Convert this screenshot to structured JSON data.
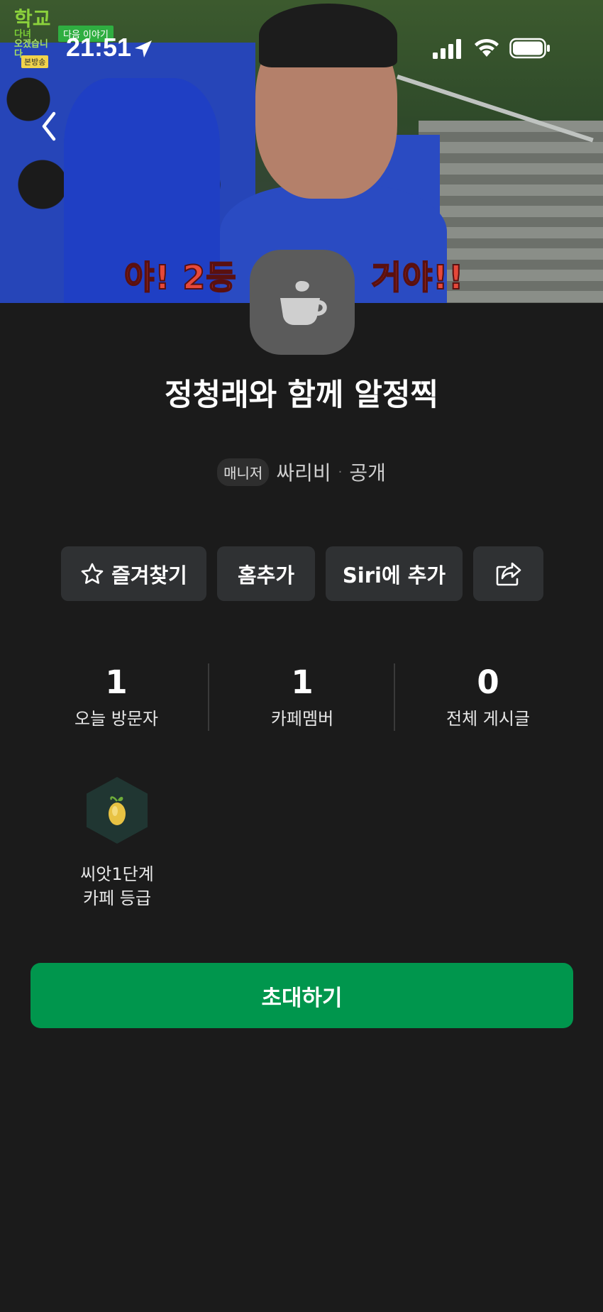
{
  "status_bar": {
    "time": "21:51"
  },
  "cover": {
    "caption_left": "야! 2등",
    "caption_right": "거야!!",
    "logo_line1": "학교",
    "logo_line2": "다녀",
    "logo_line3": "오겠습니다",
    "logo_tag": "본방송",
    "next_tag": "다음 이야기"
  },
  "cafe": {
    "title": "정청래와 함께 알정찍",
    "role_badge": "매니저",
    "manager_name": "싸리비",
    "visibility": "공개"
  },
  "actions": {
    "favorite": "즐겨찾기",
    "add_home": "홈추가",
    "siri": "Siri에 추가"
  },
  "stats": [
    {
      "value": "1",
      "label": "오늘 방문자"
    },
    {
      "value": "1",
      "label": "카페멤버"
    },
    {
      "value": "0",
      "label": "전체 게시글"
    }
  ],
  "grade": {
    "level": "씨앗1단계",
    "label": "카페 등급"
  },
  "invite_label": "초대하기",
  "colors": {
    "accent": "#00964d",
    "background": "#1b1b1b",
    "button": "#2f3133"
  }
}
